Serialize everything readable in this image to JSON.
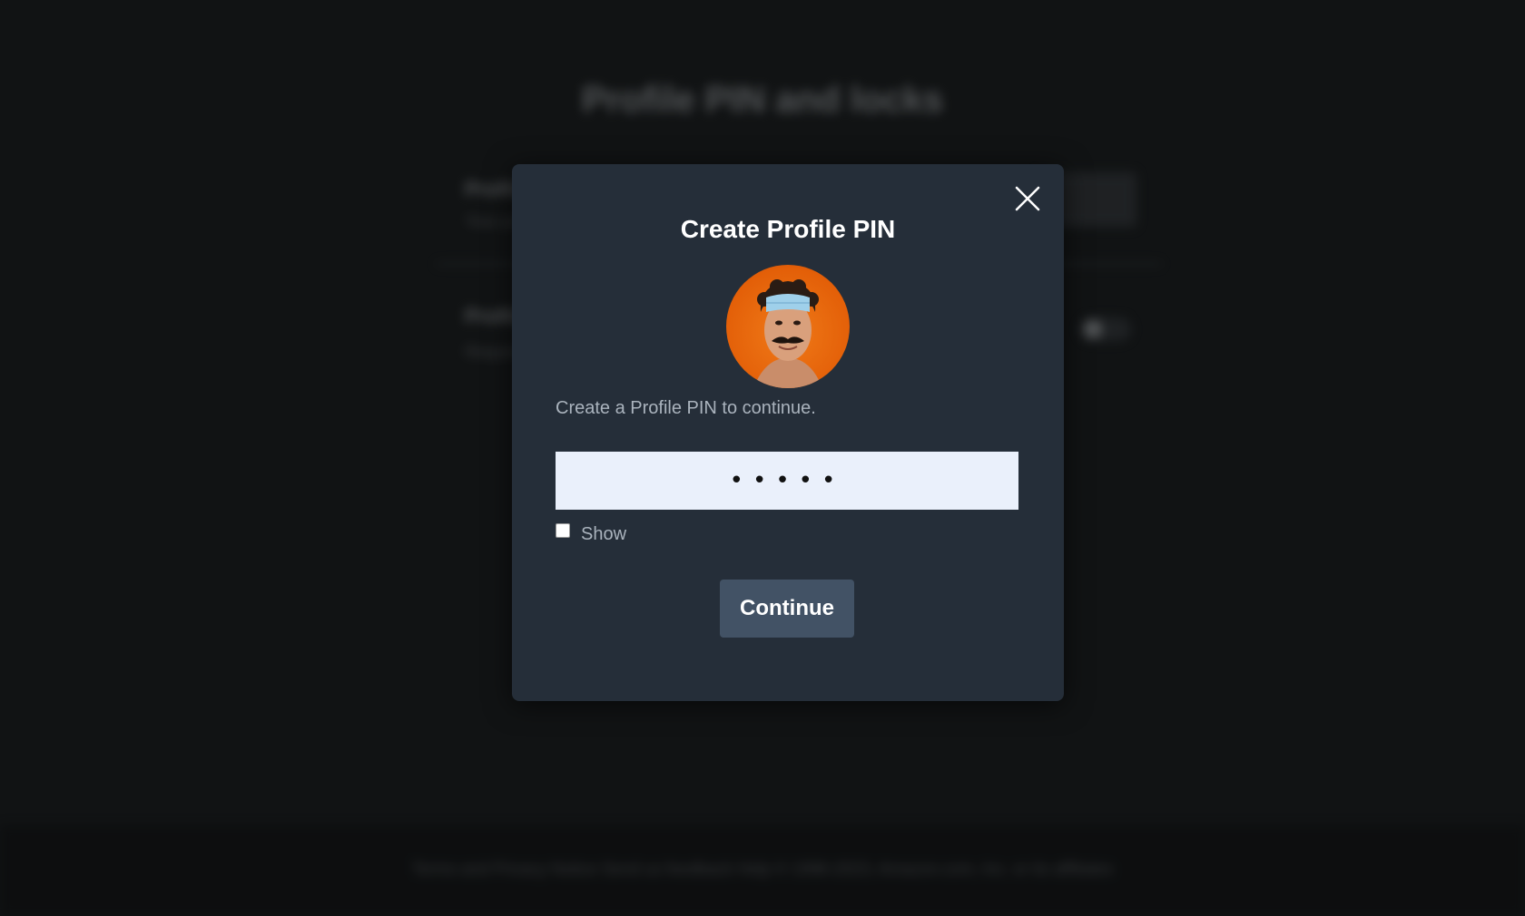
{
  "background": {
    "page_title": "Profile PIN and locks",
    "row1_title": "Profile PIN",
    "row1_sub": "Your profile PIN",
    "row2_title": "Profile lock",
    "row2_sub": "Require PIN",
    "footer_text": "Terms and Privacy Notice   Send us feedback   Help   © 1996-2023, Amazon.com, Inc. or its affiliates"
  },
  "modal": {
    "title": "Create Profile PIN",
    "avatar_icon": "profile-avatar",
    "prompt": "Create a Profile PIN to continue.",
    "pin_input": {
      "value": "•••••",
      "placeholder": ""
    },
    "show_checkbox": {
      "label": "Show",
      "checked": false
    },
    "continue_label": "Continue",
    "close_icon": "close-icon"
  },
  "colors": {
    "modal_bg": "#252e39",
    "input_bg": "#eaf0fb",
    "button_bg": "#425265"
  }
}
